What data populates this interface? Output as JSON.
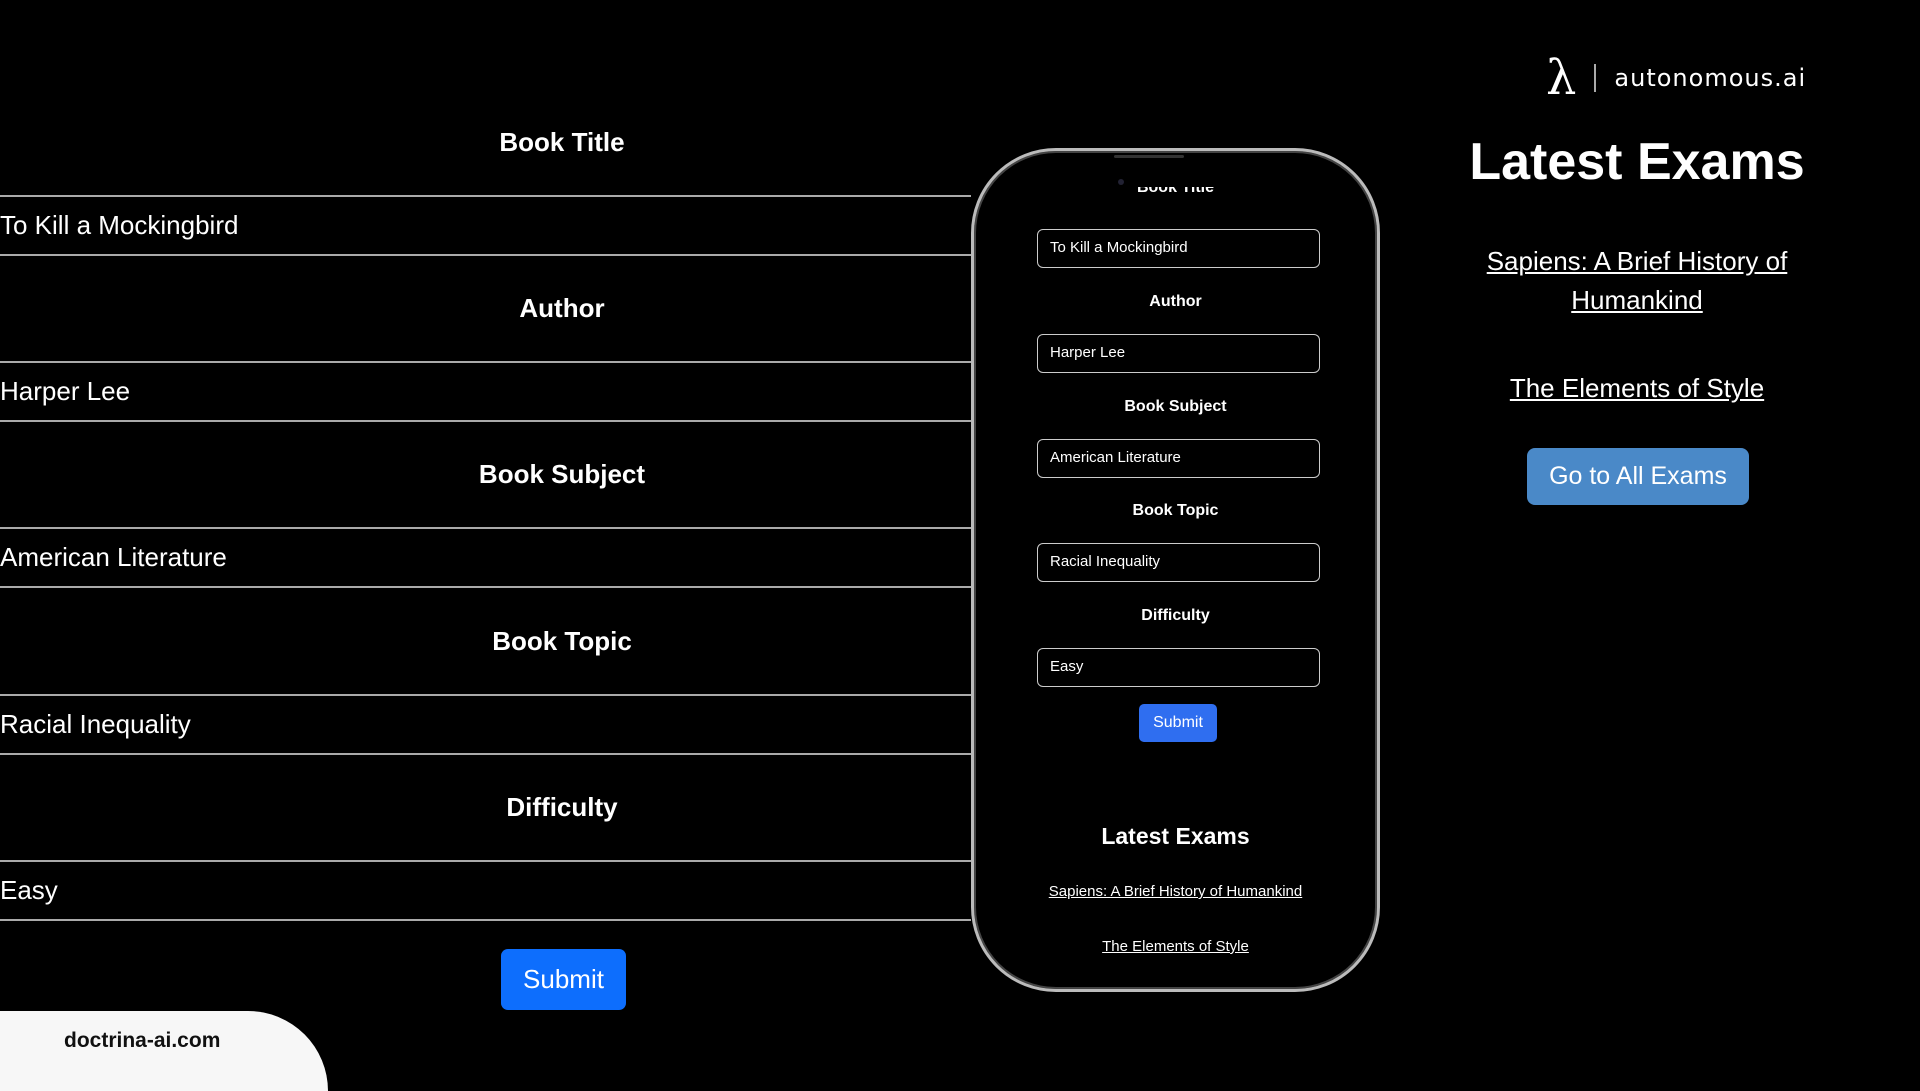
{
  "form": {
    "fields": [
      {
        "label": "Book Title",
        "value": "To Kill a Mockingbird"
      },
      {
        "label": "Author",
        "value": "Harper Lee"
      },
      {
        "label": "Book Subject",
        "value": "American Literature"
      },
      {
        "label": "Book Topic",
        "value": "Racial Inequality"
      },
      {
        "label": "Difficulty",
        "value": "Easy"
      }
    ],
    "submit_label": "Submit"
  },
  "phone": {
    "latest_title": "Latest Exams",
    "links": [
      "Sapiens: A Brief History of Humankind",
      "The Elements of Style"
    ]
  },
  "right": {
    "brand": "autonomous.ai",
    "brand_logo": "λ",
    "title": "Latest Exams",
    "links": [
      "Sapiens: A Brief History of Humankind",
      "The Elements of Style"
    ],
    "button_label": "Go to All Exams"
  },
  "footer": {
    "site": "doctrina-ai.com"
  },
  "colors": {
    "submit": "#0d6efd",
    "go_button": "#4a89c8"
  }
}
